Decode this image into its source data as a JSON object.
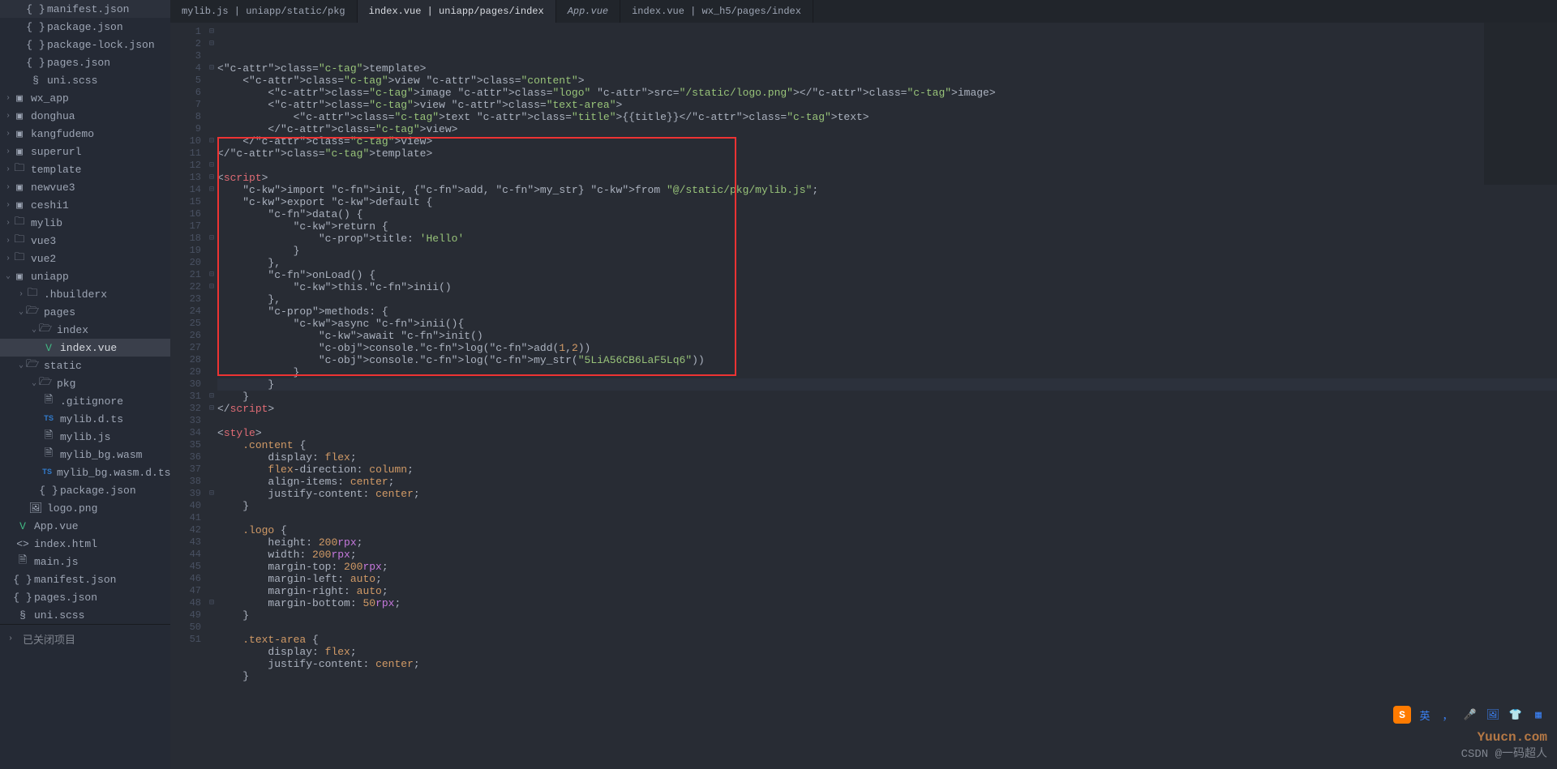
{
  "tabs": [
    {
      "label": "mylib.js | uniapp/static/pkg"
    },
    {
      "label": "index.vue | uniapp/pages/index",
      "active": true
    },
    {
      "label": "App.vue",
      "italic": true
    },
    {
      "label": "index.vue | wx_h5/pages/index"
    }
  ],
  "sidebar": {
    "top_files": [
      "manifest.json",
      "package.json",
      "package-lock.json",
      "pages.json",
      "uni.scss"
    ],
    "folders": [
      "wx_app",
      "donghua",
      "kangfudemo",
      "superurl",
      "template",
      "newvue3",
      "ceshi1",
      "mylib",
      "vue3",
      "vue2"
    ],
    "uniapp": {
      "label": "uniapp",
      "hbuilderx": ".hbuilderx",
      "pages": "pages",
      "index_folder": "index",
      "index_vue": "index.vue",
      "static": "static",
      "pkg": "pkg",
      "pkg_files": [
        ".gitignore",
        "mylib.d.ts",
        "mylib.js",
        "mylib_bg.wasm",
        "mylib_bg.wasm.d.ts",
        "package.json"
      ],
      "logo_png": "logo.png",
      "root_files": [
        "App.vue",
        "index.html",
        "main.js",
        "manifest.json",
        "pages.json",
        "uni.scss"
      ]
    },
    "closed_projects": "已关闭项目"
  },
  "code": {
    "lines": [
      "<template>",
      "    <view class=\"content\">",
      "        <image class=\"logo\" src=\"/static/logo.png\"></image>",
      "        <view class=\"text-area\">",
      "            <text class=\"title\">{{title}}</text>",
      "        </view>",
      "    </view>",
      "</template>",
      "",
      "<script>",
      "    import init, {add, my_str} from \"@/static/pkg/mylib.js\";",
      "    export default {",
      "        data() {",
      "            return {",
      "                title: 'Hello'",
      "            }",
      "        },",
      "        onLoad() {",
      "            this.inii()",
      "        },",
      "        methods: {",
      "            async inii(){",
      "                await init()",
      "                console.log(add(1,2))",
      "                console.log(my_str(\"5LiA56CB6LaF5Lq6\"))",
      "            }",
      "        }",
      "    }",
      "</script>",
      "",
      "<style>",
      "    .content {",
      "        display: flex;",
      "        flex-direction: column;",
      "        align-items: center;",
      "        justify-content: center;",
      "    }",
      "",
      "    .logo {",
      "        height: 200rpx;",
      "        width: 200rpx;",
      "        margin-top: 200rpx;",
      "        margin-left: auto;",
      "        margin-right: auto;",
      "        margin-bottom: 50rpx;",
      "    }",
      "",
      "    .text-area {",
      "        display: flex;",
      "        justify-content: center;",
      "    }"
    ]
  },
  "watermarks": {
    "csdn": "CSDN @一码超人",
    "yuucn": "Yuucn.com"
  },
  "ime": {
    "s": "S",
    "lang": "英 ",
    "punct": "，",
    "mic": "🎤",
    "img": "🖼",
    "shirt": "👕",
    "grid": "▦"
  }
}
